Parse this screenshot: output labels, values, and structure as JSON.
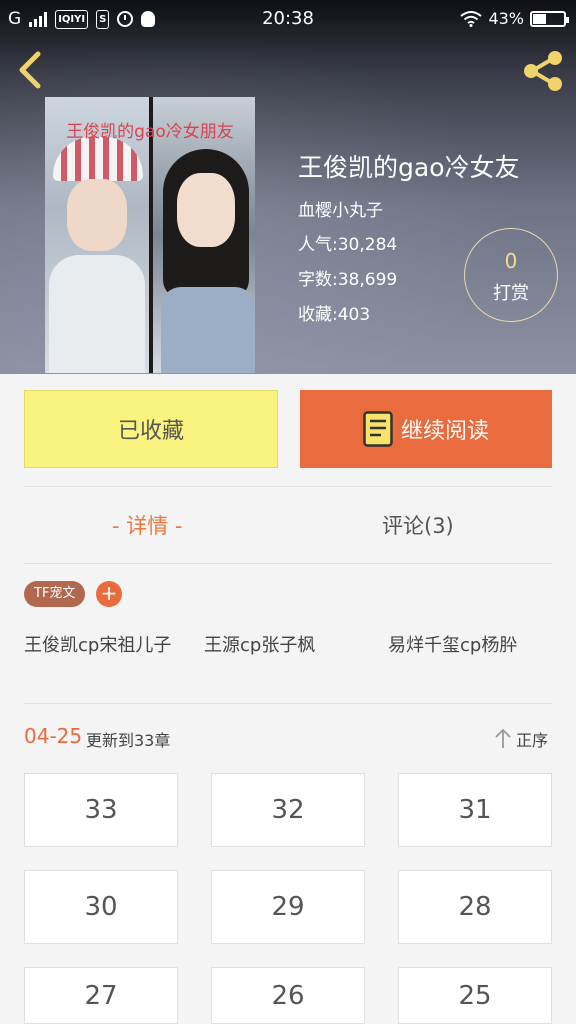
{
  "status_bar": {
    "carrier": "G",
    "app_icon_1": "IQIYI",
    "app_icon_2": "S",
    "time": "20:38",
    "battery_text": "43%",
    "battery_level": 0.43
  },
  "header": {
    "back_icon": "chevron-left-icon",
    "share_icon": "share-icon",
    "cover_title": "王俊凯的gao冷女朋友",
    "book_title": "王俊凯的gao冷女友",
    "author": "血樱小丸子",
    "popularity": "人气:30,284",
    "word_count": "字数:38,699",
    "favorites": "收藏:403",
    "tip_count": "0",
    "tip_label": "打赏"
  },
  "actions": {
    "collected_label": "已收藏",
    "continue_label": "继续阅读",
    "continue_icon": "book-icon"
  },
  "tabs": {
    "detail": "- 详情 -",
    "comments": "评论(3)"
  },
  "tags": {
    "chip": "TF宠文",
    "add": "+"
  },
  "cp_pairs": [
    "王俊凯cp宋祖儿子",
    "王源cp张子枫",
    "易烊千玺cp杨肸"
  ],
  "update": {
    "date": "04-25",
    "text": "更新到33章",
    "sort_label": "正序",
    "sort_icon": "arrow-up-icon"
  },
  "chapters": [
    "33",
    "32",
    "31",
    "30",
    "29",
    "28",
    "27",
    "26",
    "25"
  ],
  "colors": {
    "accent": "#ea6b3e",
    "collected": "#fbf37f",
    "tip_gold": "#f3dd86"
  }
}
